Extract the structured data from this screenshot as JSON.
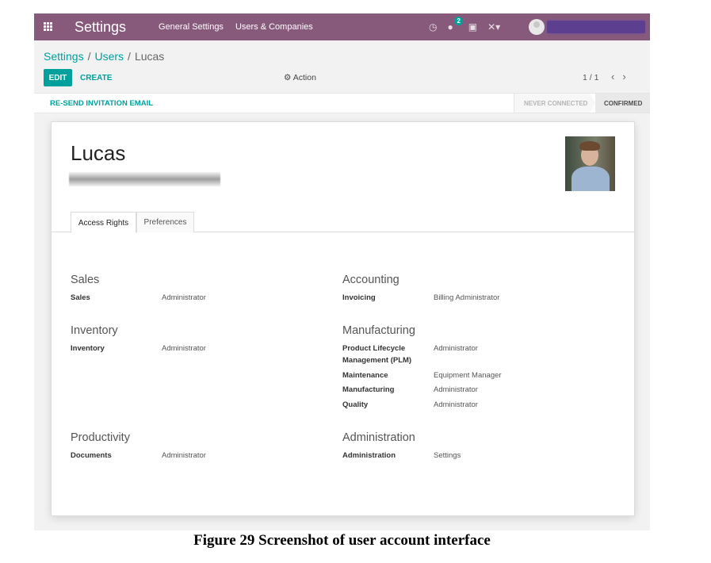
{
  "navbar": {
    "app_title": "Settings",
    "menu": [
      "General Settings",
      "Users & Companies"
    ],
    "messages_count": "2",
    "icons": [
      "apps-grid-icon",
      "clock-icon",
      "chat-icon",
      "gift-icon",
      "debug-tools-icon"
    ],
    "accent_color": "#875a7b"
  },
  "breadcrumb": {
    "items": [
      "Settings",
      "Users"
    ],
    "current": "Lucas"
  },
  "buttons": {
    "edit": "EDIT",
    "create": "CREATE",
    "action": "Action"
  },
  "pager": {
    "value": "1 / 1",
    "prev": "‹",
    "next": "›"
  },
  "statusbar": {
    "resend": "RE-SEND INVITATION EMAIL",
    "stages": [
      "NEVER CONNECTED",
      "CONFIRMED"
    ],
    "active_stage": "CONFIRMED"
  },
  "form": {
    "name": "Lucas",
    "tabs": [
      "Access Rights",
      "Preferences"
    ],
    "active_tab": "Access Rights",
    "groups": [
      {
        "title": "Sales",
        "fields": [
          {
            "label": "Sales",
            "value": "Administrator"
          }
        ]
      },
      {
        "title": "Accounting",
        "fields": [
          {
            "label": "Invoicing",
            "value": "Billing Administrator"
          }
        ]
      },
      {
        "title": "Inventory",
        "fields": [
          {
            "label": "Inventory",
            "value": "Administrator"
          }
        ]
      },
      {
        "title": "Manufacturing",
        "fields": [
          {
            "label": "Product Lifecycle Management (PLM)",
            "value": "Administrator"
          },
          {
            "label": "Maintenance",
            "value": "Equipment Manager"
          },
          {
            "label": "Manufacturing",
            "value": "Administrator"
          },
          {
            "label": "Quality",
            "value": "Administrator"
          }
        ]
      },
      {
        "title": "Productivity",
        "fields": [
          {
            "label": "Documents",
            "value": "Administrator"
          }
        ]
      },
      {
        "title": "Administration",
        "fields": [
          {
            "label": "Administration",
            "value": "Settings"
          }
        ]
      }
    ]
  },
  "caption": "Figure 29 Screenshot of user account interface",
  "colors": {
    "primary": "#00a09d",
    "navbar": "#875a7b"
  }
}
